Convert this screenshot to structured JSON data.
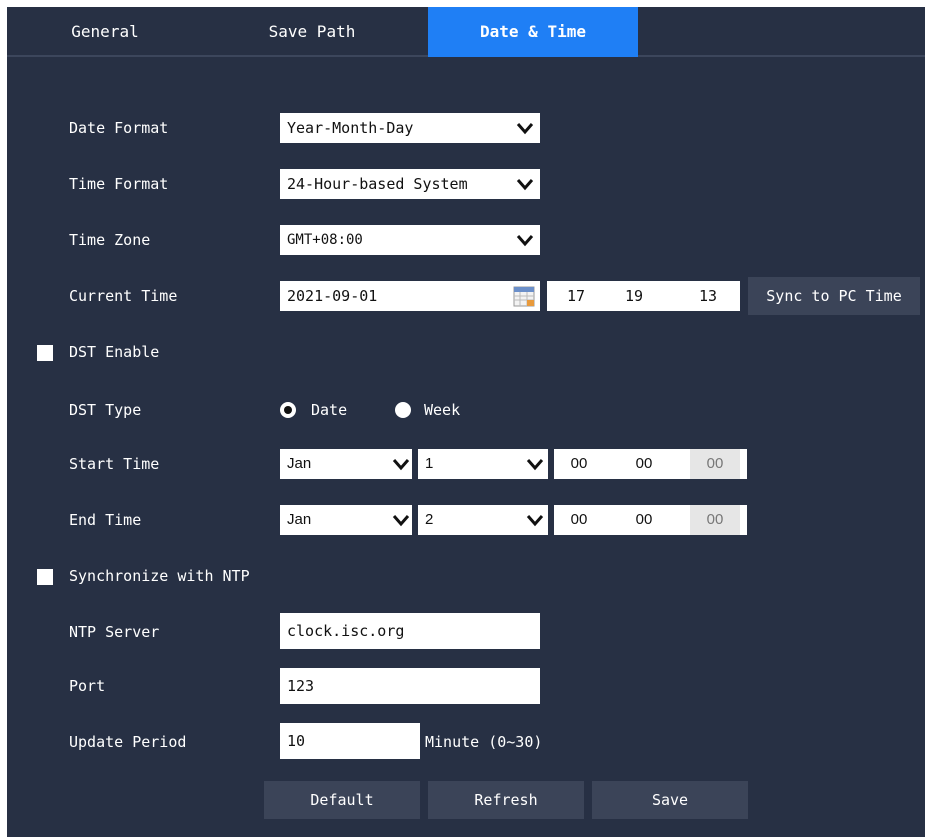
{
  "tabs": [
    {
      "label": "General"
    },
    {
      "label": "Save Path"
    },
    {
      "label": "Date & Time"
    }
  ],
  "active_tab": "Date & Time",
  "form": {
    "date_format": {
      "label": "Date Format",
      "value": "Year-Month-Day"
    },
    "time_format": {
      "label": "Time Format",
      "value": "24-Hour-based System"
    },
    "time_zone": {
      "label": "Time Zone",
      "value": "GMT+08:00"
    },
    "current_time": {
      "label": "Current Time",
      "date": "2021-09-01",
      "hour": "17",
      "minute": "19",
      "second": "13",
      "sync_button": "Sync to PC Time"
    },
    "dst_enable": {
      "label": "DST Enable",
      "checked": false
    },
    "dst_type": {
      "label": "DST Type",
      "option_date": "Date",
      "option_week": "Week",
      "selected": "Date"
    },
    "start_time": {
      "label": "Start Time",
      "month": "Jan",
      "day": "1",
      "hour": "00",
      "minute": "00",
      "second": "00"
    },
    "end_time": {
      "label": "End Time",
      "month": "Jan",
      "day": "2",
      "hour": "00",
      "minute": "00",
      "second": "00"
    },
    "sync_ntp": {
      "label": "Synchronize with NTP",
      "checked": false
    },
    "ntp_server": {
      "label": "NTP Server",
      "value": "clock.isc.org"
    },
    "port": {
      "label": "Port",
      "value": "123"
    },
    "update_period": {
      "label": "Update Period",
      "value": "10",
      "unit": "Minute (0~30)"
    }
  },
  "buttons": {
    "default": "Default",
    "refresh": "Refresh",
    "save": "Save"
  },
  "colors": {
    "panel_bg": "#273044",
    "active_tab": "#1f7ff5",
    "button_bg": "#3b4458"
  }
}
